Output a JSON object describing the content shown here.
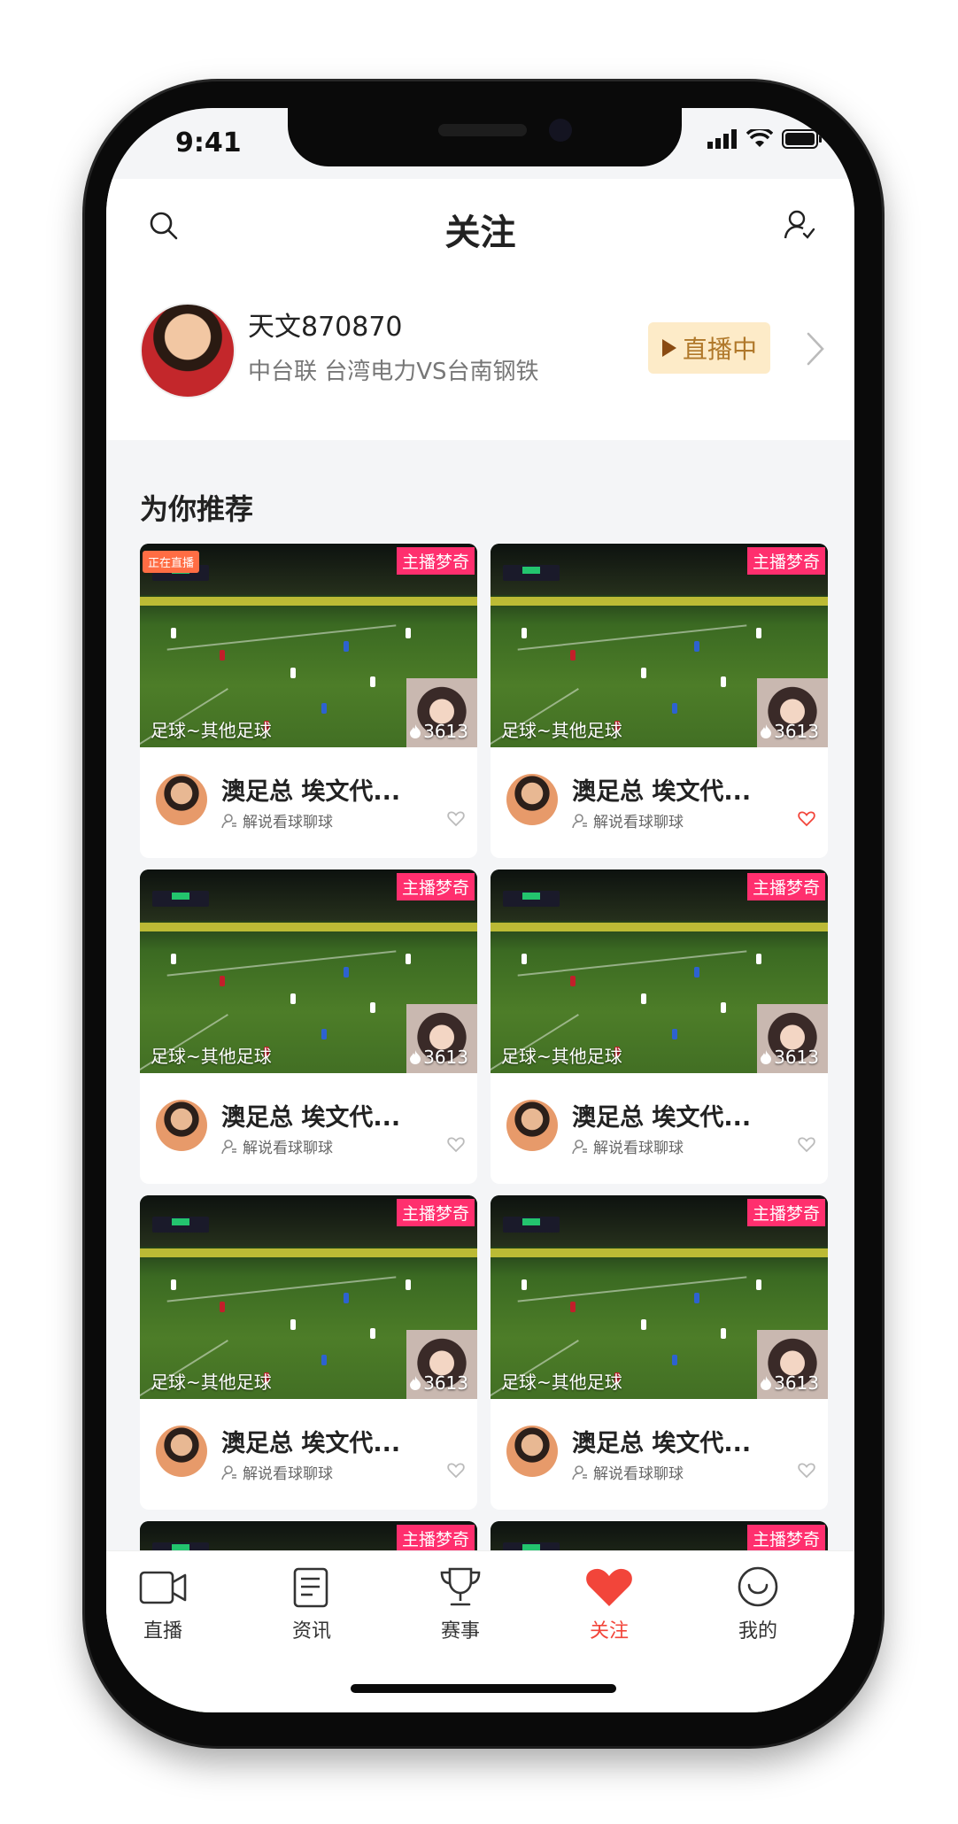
{
  "status_bar": {
    "time": "9:41"
  },
  "header": {
    "title": "关注"
  },
  "follow": {
    "name": "天文870870",
    "subtitle": "中台联 台湾电力VS台南钢铁",
    "live_label": "直播中"
  },
  "section_title": "为你推荐",
  "cards": [
    {
      "host_badge": "主播梦奇",
      "live_badge": "正在直播",
      "category": "足球~其他足球",
      "heat": "3613",
      "title": "澳足总 埃文代...",
      "sub": "解说看球聊球",
      "liked": false
    },
    {
      "host_badge": "主播梦奇",
      "live_badge": "",
      "category": "足球~其他足球",
      "heat": "3613",
      "title": "澳足总 埃文代...",
      "sub": "解说看球聊球",
      "liked": true
    },
    {
      "host_badge": "主播梦奇",
      "live_badge": "",
      "category": "足球~其他足球",
      "heat": "3613",
      "title": "澳足总 埃文代...",
      "sub": "解说看球聊球",
      "liked": false
    },
    {
      "host_badge": "主播梦奇",
      "live_badge": "",
      "category": "足球~其他足球",
      "heat": "3613",
      "title": "澳足总 埃文代...",
      "sub": "解说看球聊球",
      "liked": false
    },
    {
      "host_badge": "主播梦奇",
      "live_badge": "",
      "category": "足球~其他足球",
      "heat": "3613",
      "title": "澳足总 埃文代...",
      "sub": "解说看球聊球",
      "liked": false
    },
    {
      "host_badge": "主播梦奇",
      "live_badge": "",
      "category": "足球~其他足球",
      "heat": "3613",
      "title": "澳足总 埃文代...",
      "sub": "解说看球聊球",
      "liked": false
    },
    {
      "host_badge": "主播梦奇",
      "live_badge": "",
      "category": "",
      "heat": "",
      "title": "",
      "sub": "",
      "liked": false
    },
    {
      "host_badge": "主播梦奇",
      "live_badge": "",
      "category": "",
      "heat": "",
      "title": "",
      "sub": "",
      "liked": false
    }
  ],
  "tabs": [
    {
      "label": "直播",
      "icon": "video-camera-icon",
      "active": false
    },
    {
      "label": "资讯",
      "icon": "news-document-icon",
      "active": false
    },
    {
      "label": "赛事",
      "icon": "trophy-icon",
      "active": false
    },
    {
      "label": "关注",
      "icon": "heart-icon",
      "active": true
    },
    {
      "label": "我的",
      "icon": "profile-icon",
      "active": false
    }
  ],
  "colors": {
    "accent": "#f2453a",
    "live_pill_bg": "#fdebc8",
    "live_pill_text": "#b0782a",
    "host_badge": "#ff2f6e",
    "live_badge": "#ff6d44"
  }
}
